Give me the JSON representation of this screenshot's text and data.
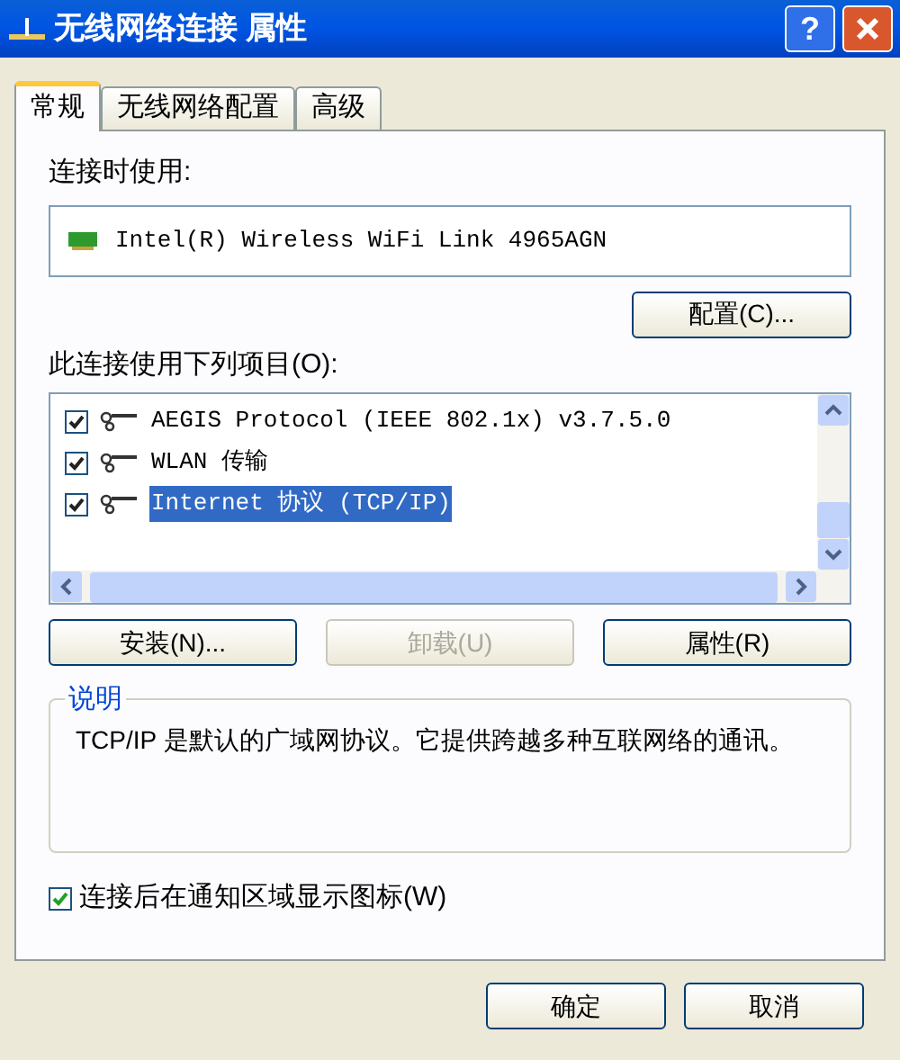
{
  "window": {
    "title": "无线网络连接 属性",
    "help_button": "?"
  },
  "tabs": [
    {
      "label": "常规",
      "selected": true
    },
    {
      "label": "无线网络配置",
      "selected": false
    },
    {
      "label": "高级",
      "selected": false
    }
  ],
  "connect_using": {
    "label": "连接时使用:",
    "adapter": "Intel(R) Wireless WiFi Link 4965AGN",
    "configure_button": "配置(C)..."
  },
  "components": {
    "label": "此连接使用下列项目(O):",
    "items": [
      {
        "label": "AEGIS Protocol (IEEE 802.1x) v3.7.5.0",
        "checked": true,
        "selected": false
      },
      {
        "label": "WLAN 传输",
        "checked": true,
        "selected": false
      },
      {
        "label": "Internet 协议 (TCP/IP)",
        "checked": true,
        "selected": true
      }
    ]
  },
  "action_buttons": [
    {
      "label": "安装(N)...",
      "disabled": false
    },
    {
      "label": "卸载(U)",
      "disabled": true
    },
    {
      "label": "属性(R)",
      "disabled": false
    }
  ],
  "description": {
    "title": "说明",
    "text": "TCP/IP 是默认的广域网协议。它提供跨越多种互联网络的通讯。"
  },
  "notify_checkbox": {
    "label": "连接后在通知区域显示图标(W)",
    "checked": true
  },
  "footer_buttons": [
    {
      "label": "确定",
      "disabled": false
    },
    {
      "label": "取消",
      "disabled": false
    }
  ]
}
